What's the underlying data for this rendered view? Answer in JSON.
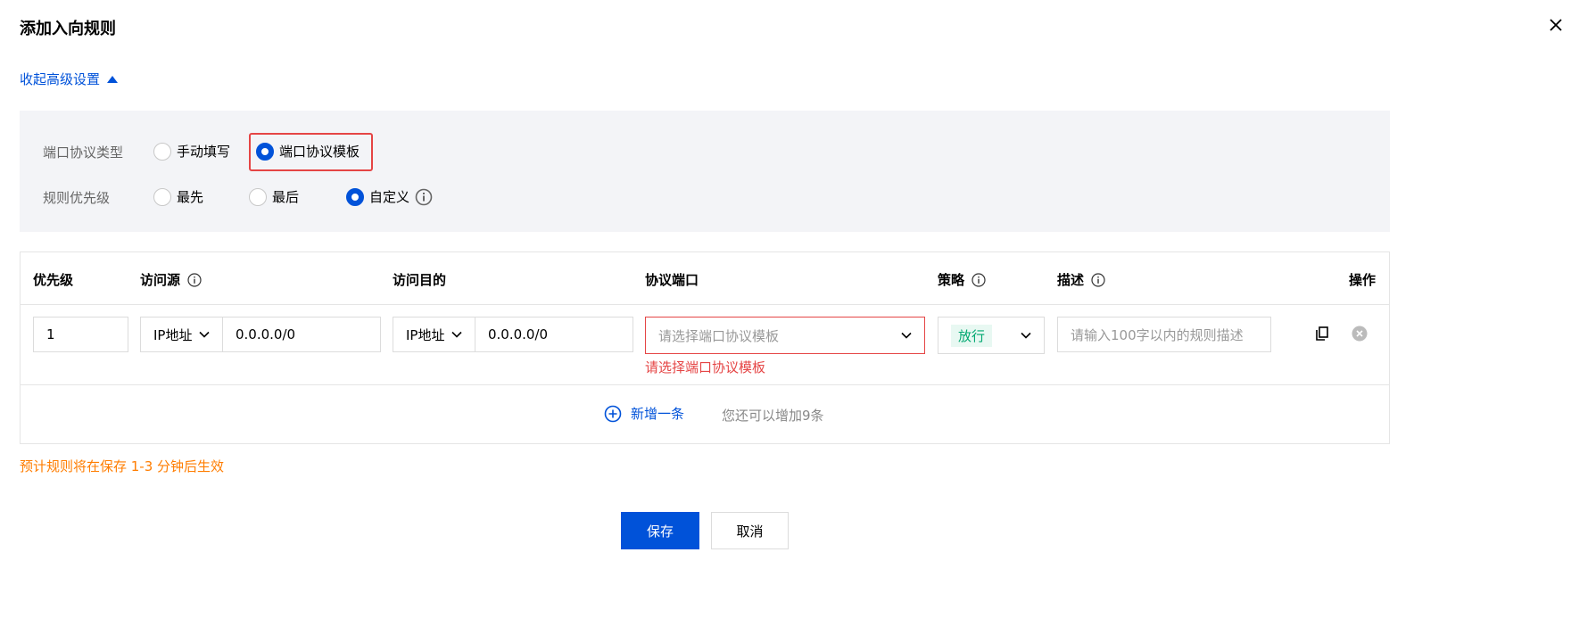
{
  "dialog": {
    "title": "添加入向规则"
  },
  "collapse_label": "收起高级设置",
  "advanced": {
    "port_type_label": "端口协议类型",
    "port_type_options": [
      "手动填写",
      "端口协议模板"
    ],
    "port_type_selected": "端口协议模板",
    "priority_label": "规则优先级",
    "priority_options": [
      "最先",
      "最后",
      "自定义"
    ],
    "priority_selected": "自定义"
  },
  "table": {
    "headers": {
      "priority": "优先级",
      "source": "访问源",
      "destination": "访问目的",
      "protocol_port": "协议端口",
      "policy": "策略",
      "description": "描述",
      "operation": "操作"
    },
    "row": {
      "priority_value": "1",
      "source_type": "IP地址",
      "source_value": "0.0.0.0/0",
      "dest_type": "IP地址",
      "dest_value": "0.0.0.0/0",
      "protocol_placeholder": "请选择端口协议模板",
      "protocol_error": "请选择端口协议模板",
      "policy_value": "放行",
      "description_placeholder": "请输入100字以内的规则描述"
    },
    "add_label": "新增一条",
    "remaining_text": "您还可以增加9条"
  },
  "notice": "预计规则将在保存 1-3 分钟后生效",
  "buttons": {
    "save": "保存",
    "cancel": "取消"
  },
  "colors": {
    "primary": "#0052d9",
    "error": "#e54545",
    "warning": "#ff7d00",
    "success": "#00a870"
  }
}
